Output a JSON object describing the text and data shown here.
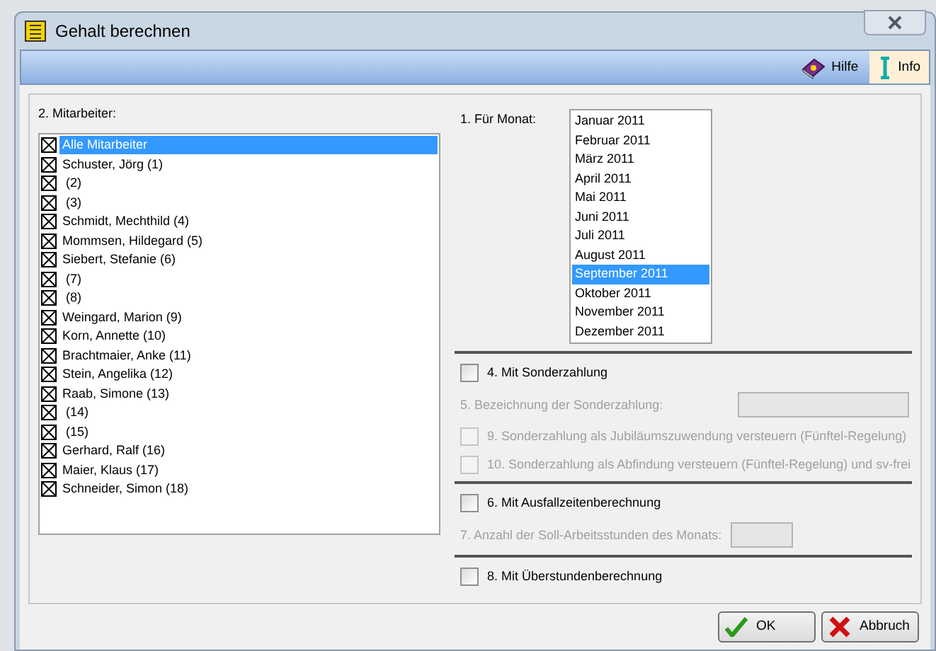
{
  "window": {
    "title": "Gehalt berechnen"
  },
  "toolbar": [
    {
      "label": "Hilfe",
      "kind": "help",
      "selected": false
    },
    {
      "label": "Info",
      "kind": "info",
      "selected": true
    }
  ],
  "employees": {
    "label": "2. Mitarbeiter:",
    "items": [
      {
        "text": "Alle Mitarbeiter",
        "checked": true,
        "selected": true
      },
      {
        "text": "Schuster, Jörg (1)",
        "checked": true,
        "selected": false
      },
      {
        "text": " (2)",
        "checked": true,
        "selected": false
      },
      {
        "text": " (3)",
        "checked": true,
        "selected": false
      },
      {
        "text": "Schmidt, Mechthild (4)",
        "checked": true,
        "selected": false
      },
      {
        "text": "Mommsen, Hildegard (5)",
        "checked": true,
        "selected": false
      },
      {
        "text": "Siebert, Stefanie (6)",
        "checked": true,
        "selected": false
      },
      {
        "text": " (7)",
        "checked": true,
        "selected": false
      },
      {
        "text": " (8)",
        "checked": true,
        "selected": false
      },
      {
        "text": "Weingard, Marion (9)",
        "checked": true,
        "selected": false
      },
      {
        "text": "Korn, Annette (10)",
        "checked": true,
        "selected": false
      },
      {
        "text": "Brachtmaier, Anke (11)",
        "checked": true,
        "selected": false
      },
      {
        "text": "Stein, Angelika (12)",
        "checked": true,
        "selected": false
      },
      {
        "text": "Raab, Simone (13)",
        "checked": true,
        "selected": false
      },
      {
        "text": " (14)",
        "checked": true,
        "selected": false
      },
      {
        "text": " (15)",
        "checked": true,
        "selected": false
      },
      {
        "text": "Gerhard, Ralf (16)",
        "checked": true,
        "selected": false
      },
      {
        "text": "Maier, Klaus (17)",
        "checked": true,
        "selected": false
      },
      {
        "text": "Schneider, Simon (18)",
        "checked": true,
        "selected": false
      }
    ]
  },
  "month": {
    "label": "1. Für Monat:",
    "items": [
      {
        "text": "Januar 2011",
        "selected": false
      },
      {
        "text": "Februar 2011",
        "selected": false
      },
      {
        "text": "März 2011",
        "selected": false
      },
      {
        "text": "April 2011",
        "selected": false
      },
      {
        "text": "Mai 2011",
        "selected": false
      },
      {
        "text": "Juni 2011",
        "selected": false
      },
      {
        "text": "Juli 2011",
        "selected": false
      },
      {
        "text": "August 2011",
        "selected": false
      },
      {
        "text": "September 2011",
        "selected": true
      },
      {
        "text": "Oktober 2011",
        "selected": false
      },
      {
        "text": "November 2011",
        "selected": false
      },
      {
        "text": "Dezember 2011",
        "selected": false
      }
    ]
  },
  "sections": [
    [
      {
        "kind": "checkbox",
        "label": "4. Mit Sonderzahlung",
        "checked": false,
        "disabled": false
      },
      {
        "kind": "field",
        "label": "5. Bezeichnung der Sonderzahlung:",
        "disabled": true
      },
      {
        "kind": "checkbox",
        "label": "9. Sonderzahlung als Jubiläumszuwendung versteuern (Fünftel-Regelung)",
        "checked": false,
        "disabled": true
      },
      {
        "kind": "checkbox",
        "label": "10. Sonderzahlung als Abfindung versteuern (Fünftel-Regelung) und sv-frei",
        "checked": false,
        "disabled": true
      }
    ],
    [
      {
        "kind": "checkbox",
        "label": "6. Mit Ausfallzeitenberechnung",
        "checked": false,
        "disabled": false
      },
      {
        "kind": "short-field",
        "label": "7. Anzahl der Soll-Arbeitsstunden des Monats:",
        "disabled": true
      }
    ],
    [
      {
        "kind": "checkbox",
        "label": "8. Mit Überstundenberechnung",
        "checked": false,
        "disabled": false
      }
    ]
  ],
  "buttons": [
    {
      "label": "OK",
      "kind": "ok"
    },
    {
      "label": "Abbruch",
      "kind": "cancel"
    }
  ]
}
